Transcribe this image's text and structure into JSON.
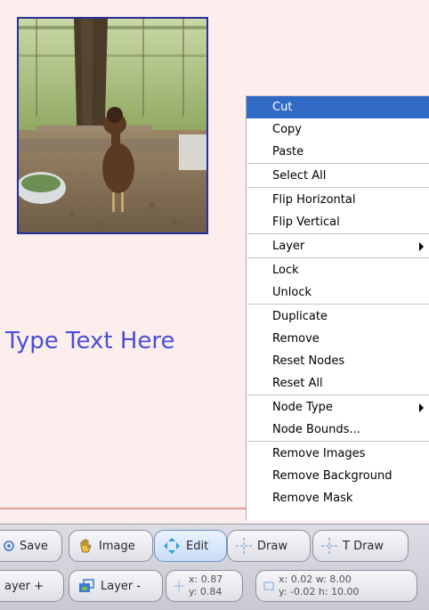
{
  "canvas": {
    "placeholder_text": "Type Text Here"
  },
  "context_menu": {
    "groups": [
      [
        {
          "label": "Cut",
          "selected": true
        },
        {
          "label": "Copy"
        },
        {
          "label": "Paste"
        }
      ],
      [
        {
          "label": "Select All"
        }
      ],
      [
        {
          "label": "Flip Horizontal"
        },
        {
          "label": "Flip Vertical"
        }
      ],
      [
        {
          "label": "Layer",
          "submenu": true
        }
      ],
      [
        {
          "label": "Lock"
        },
        {
          "label": "Unlock"
        }
      ],
      [
        {
          "label": "Duplicate"
        },
        {
          "label": "Remove"
        },
        {
          "label": "Reset Nodes"
        },
        {
          "label": "Reset All"
        }
      ],
      [
        {
          "label": "Node Type",
          "submenu": true
        },
        {
          "label": "Node Bounds..."
        }
      ],
      [
        {
          "label": "Remove Images"
        },
        {
          "label": "Remove Background"
        },
        {
          "label": "Remove Mask"
        }
      ]
    ]
  },
  "toolbar": {
    "row1": {
      "save_label": "Save",
      "image_label": "Image",
      "edit_label": "Edit",
      "draw_label": "Draw",
      "text_draw_label": "T Draw"
    },
    "row2": {
      "layer_add_label": "ayer +",
      "layer_remove_label": "Layer -",
      "cursor_x": "x: 0.87",
      "cursor_y": "y: 0.84",
      "bounds_line1": "x: 0.02 w: 8.00",
      "bounds_line2": "y: -0.02 h: 10.00"
    }
  },
  "colors": {
    "canvas_bg": "#fdeeee",
    "canvas_text": "#4a4fd6",
    "menu_selected": "#316ac5",
    "photo_border": "#2b2f9c"
  }
}
